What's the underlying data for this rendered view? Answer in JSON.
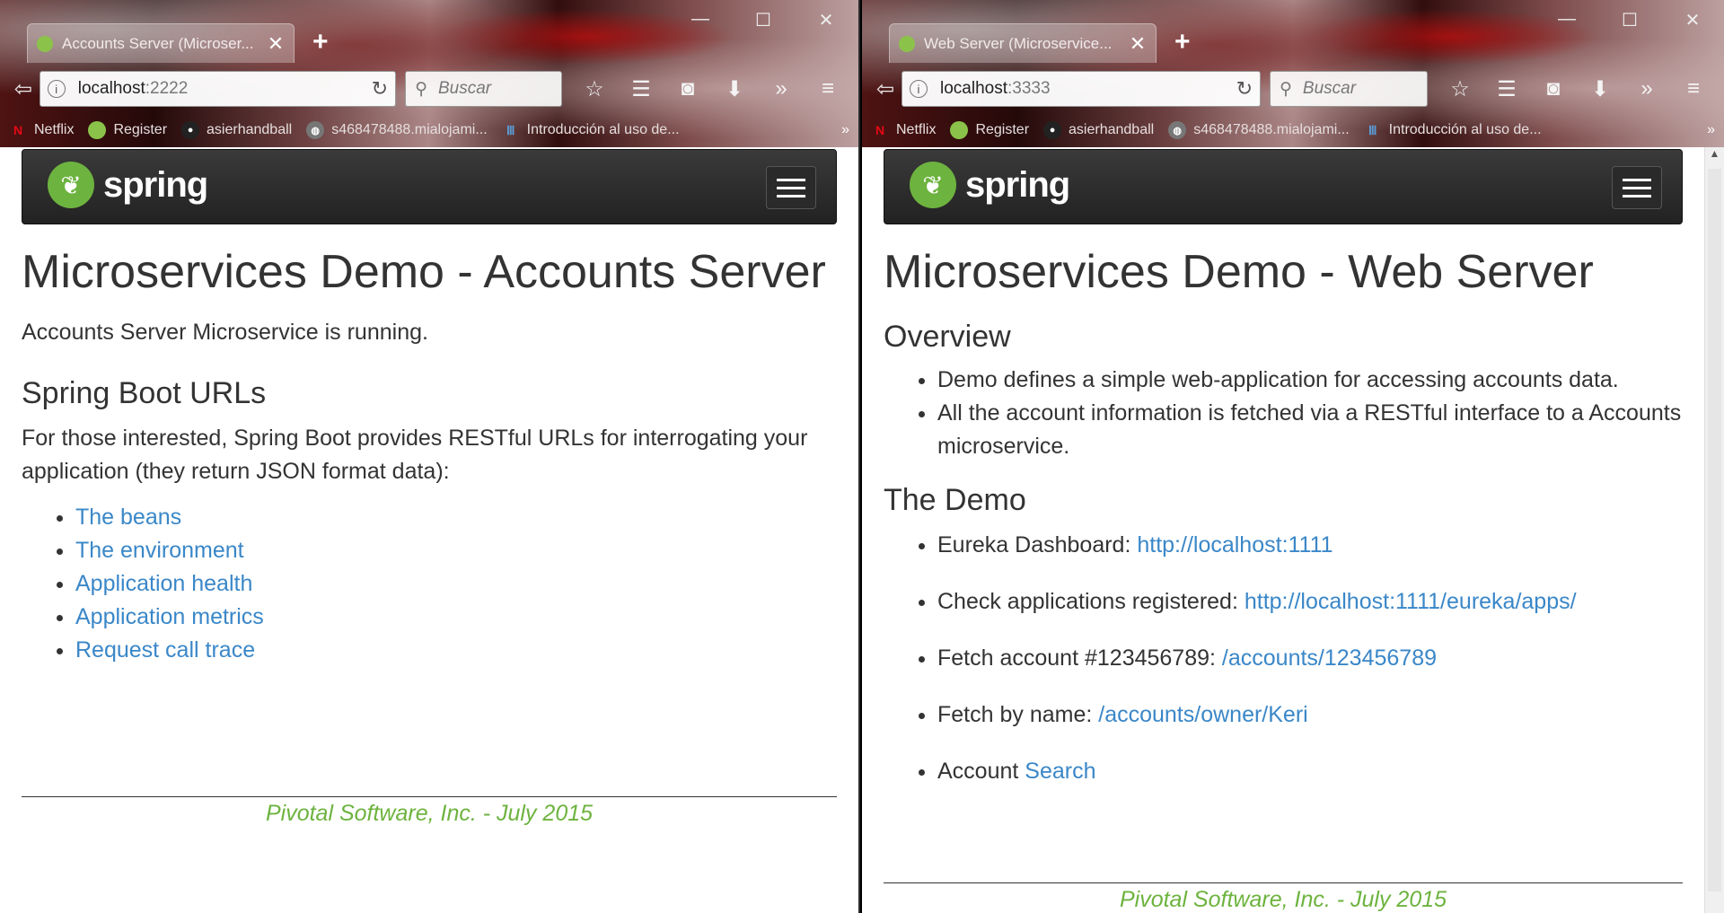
{
  "left": {
    "tab_title": "Accounts Server (Microser...",
    "url_host": "localhost",
    "url_port": ":2222",
    "search_placeholder": "Buscar",
    "page_title": "Microservices Demo - Accounts Server",
    "status_text": "Accounts Server Microservice is running.",
    "section_title": "Spring Boot URLs",
    "section_text": "For those interested, Spring Boot provides RESTful URLs for interrogating your application (they return JSON format data):",
    "links": [
      "The beans",
      "The environment",
      "Application health",
      "Application metrics",
      "Request call trace"
    ],
    "footer": "Pivotal Software, Inc. - July 2015"
  },
  "right": {
    "tab_title": "Web Server (Microservice...",
    "url_host": "localhost",
    "url_port": ":3333",
    "search_placeholder": "Buscar",
    "page_title": "Microservices Demo - Web Server",
    "overview_title": "Overview",
    "overview_items": [
      "Demo defines a simple web-application for accessing accounts data.",
      "All the account information is fetched via a RESTful interface to a Accounts microservice."
    ],
    "demo_title": "The Demo",
    "demo_items": [
      {
        "label": "Eureka Dashboard: ",
        "link": "http://localhost:1111"
      },
      {
        "label": "Check applications registered: ",
        "link": "http://localhost:1111/eureka/apps/"
      },
      {
        "label": "Fetch account #123456789: ",
        "link": "/accounts/123456789"
      },
      {
        "label": "Fetch by name: ",
        "link": "/accounts/owner/Keri"
      },
      {
        "label": "Account ",
        "link": "Search"
      }
    ],
    "footer": "Pivotal Software, Inc. - July 2015"
  },
  "bookmarks": [
    "Netflix",
    "Register",
    "asierhandball",
    "s468478488.mialojami...",
    "Introducción al uso de..."
  ],
  "logo_text": "spring",
  "window_controls": {
    "minimize": "—",
    "maximize": "☐",
    "close": "✕"
  },
  "colors": {
    "link": "#3a87c8",
    "spring_green": "#6db33f",
    "navbar": "#2a2a2a"
  }
}
